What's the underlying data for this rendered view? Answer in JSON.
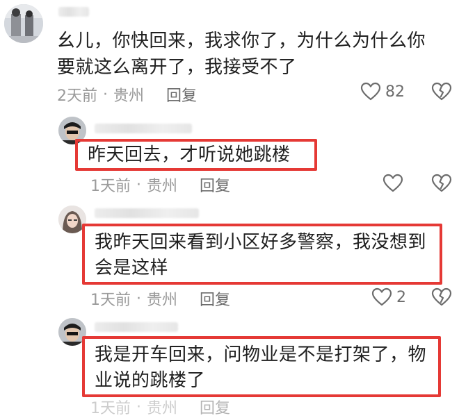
{
  "comments": [
    {
      "text_lines": [
        "幺儿，你快回来，我求你了，为什么为什么你",
        "要就这么离开了，我接受不了"
      ],
      "time": "2天前",
      "separator": "·",
      "location": "贵州",
      "reply_label": "回复",
      "like_count": "82",
      "highlighted": false
    },
    {
      "text_lines": [
        "昨天回去，才听说她跳楼"
      ],
      "time": "1天前",
      "separator": "·",
      "location": "贵州",
      "reply_label": "回复",
      "like_count": "",
      "highlighted": true
    },
    {
      "text_lines": [
        "我昨天回来看到小区好多警察，我没想到",
        "会是这样"
      ],
      "time": "1天前",
      "separator": "·",
      "location": "贵州",
      "reply_label": "回复",
      "like_count": "2",
      "highlighted": true
    },
    {
      "text_lines": [
        "我是开车回来，问物业是不是打架了，物",
        "业说的跳楼了"
      ],
      "time": "1天前",
      "separator": "·",
      "location": "贵州",
      "reply_label": "回复",
      "like_count": "",
      "highlighted": true
    }
  ],
  "colors": {
    "highlight_border": "#e53935",
    "text": "#202020",
    "meta": "#9a9a9a",
    "icon": "#6c6c6c"
  },
  "icons": {
    "like": "heart-outline-icon",
    "dislike": "broken-heart-icon"
  }
}
